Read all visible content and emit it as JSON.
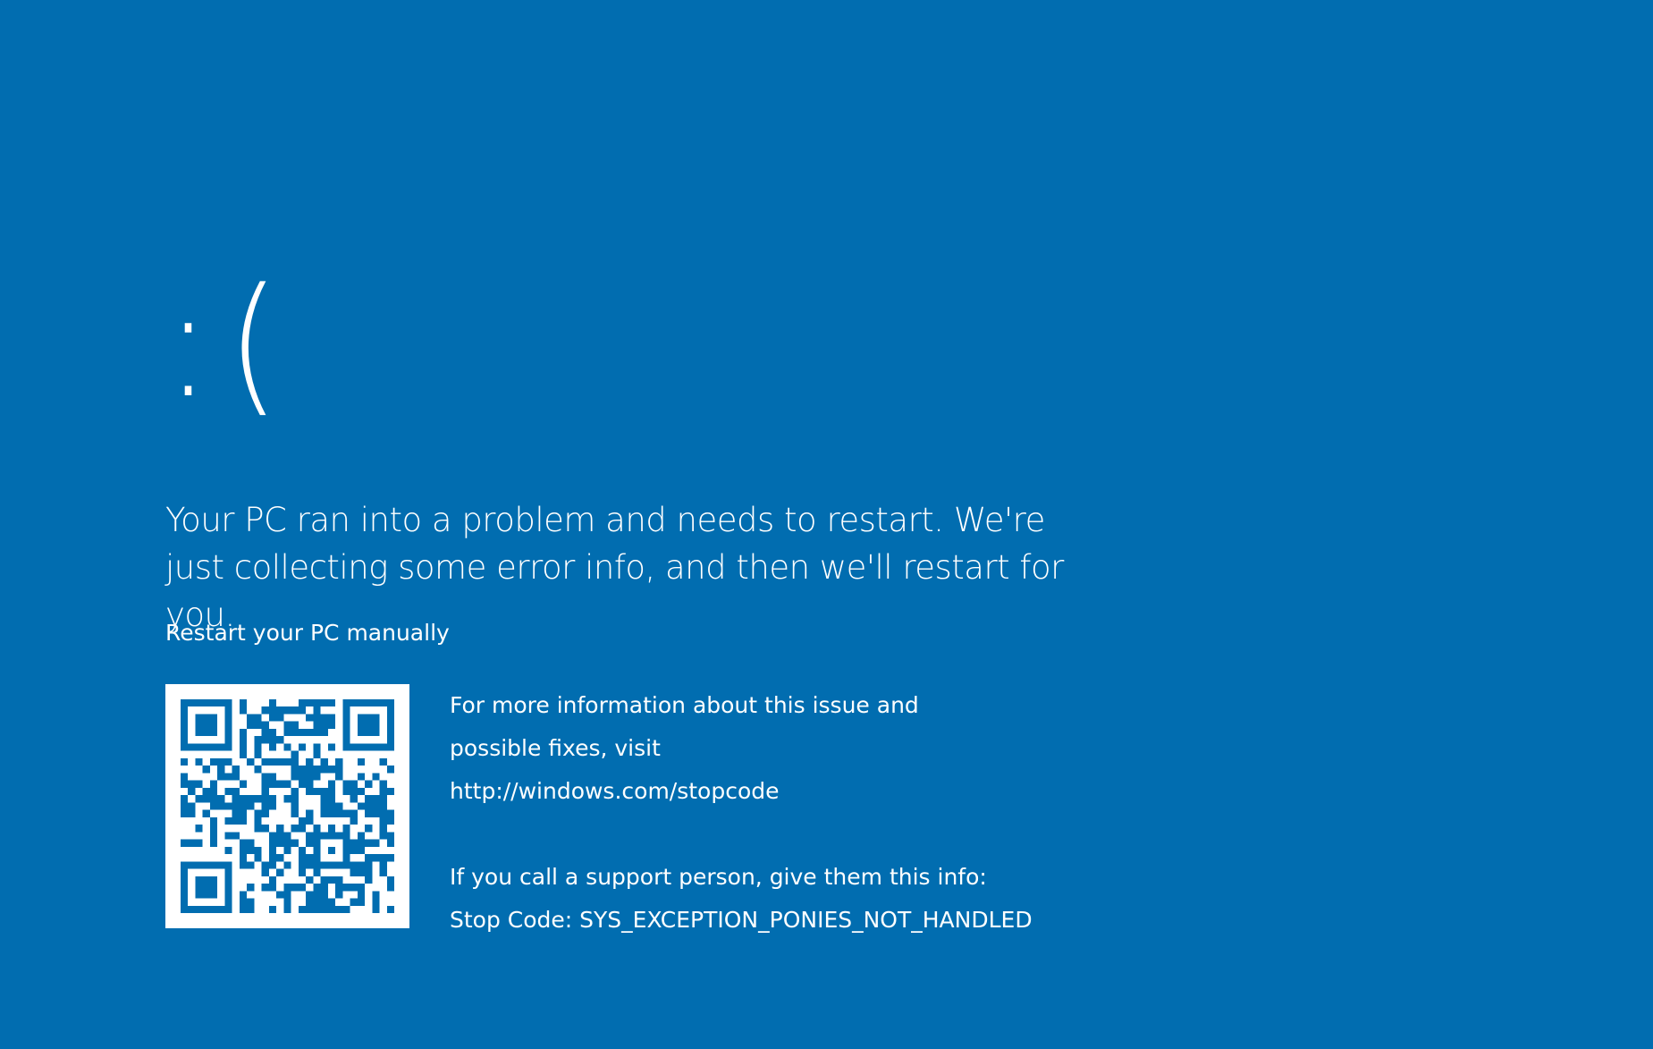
{
  "colors": {
    "background": "#016DB0",
    "text": "#FFFFFF",
    "qr_background": "#FFFFFF",
    "qr_modules": "#016DB0"
  },
  "screen": {
    "sad_face": ":(",
    "headline": "Your PC ran into a problem and needs to restart. We're just collecting some error info, and then we'll restart for you.",
    "restart_manual": "Restart your PC manually",
    "info": {
      "more_info_line1": "For more information about this issue and",
      "more_info_line2": "possible fixes, visit",
      "url": "http://windows.com/stopcode",
      "support_line": "If you call a support person, give them this info:",
      "stop_code": "Stop Code: SYS_EXCEPTION_PONIES_NOT_HANDLED"
    }
  },
  "icons": {
    "qr_code": "qr-code-icon"
  }
}
